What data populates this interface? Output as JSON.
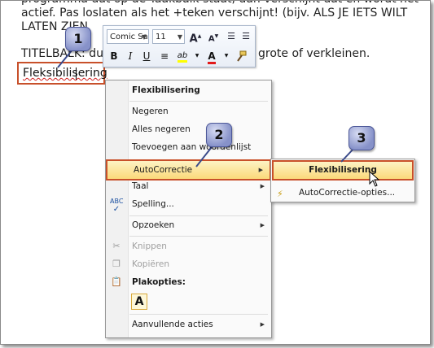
{
  "document": {
    "lines": [
      "programma dat op de Taakbalk staat, dan verschijnt dat en wordt het",
      "actief. Pas loslaten als het +teken verschijnt! (bijv. ALS JE IETS WILT",
      "LATEN ZIEN"
    ],
    "titelbalk_start": "TITELBALK: du",
    "titelbalk_end": "grote of verkleinen.",
    "selected_word": "Fleksibilisering"
  },
  "mini_toolbar": {
    "font_name": "Comic Sa",
    "font_size": "11",
    "buttons": [
      "grow-font",
      "shrink-font",
      "decrease-indent",
      "increase-indent",
      "bold",
      "italic",
      "underline",
      "center",
      "highlight",
      "font-color",
      "format-painter"
    ],
    "labels": {
      "grow": "A",
      "shrink": "A",
      "bold": "B",
      "italic": "I",
      "underline": "U",
      "highlight": "ab",
      "font_color": "A"
    },
    "colors": {
      "highlight": "#ffff00",
      "font_color": "#e21a1a"
    }
  },
  "context_menu": {
    "header": "Flexibilisering",
    "items": [
      {
        "label": "Negeren"
      },
      {
        "label": "Alles negeren"
      },
      {
        "label": "Toevoegen aan woordenlijst"
      },
      {
        "label": "AutoCorrectie",
        "submenu": true,
        "highlighted": true
      },
      {
        "label": "Taal",
        "submenu": true
      },
      {
        "label": "Spelling..."
      },
      {
        "label": "Opzoeken",
        "submenu": true
      },
      {
        "label": "Knippen",
        "disabled": true
      },
      {
        "label": "Kopiëren",
        "disabled": true
      },
      {
        "label": "Plakopties:",
        "bold": true
      },
      {
        "label": "Aanvullende acties",
        "submenu": true
      }
    ],
    "paste_option": "A"
  },
  "submenu": {
    "suggestion": "Flexibilisering",
    "options_label": "AutoCorrectie-opties..."
  },
  "callouts": [
    "1",
    "2",
    "3"
  ],
  "colors": {
    "highlight_border": "#c8502a",
    "highlight_fill": "#fbd97a",
    "badge": "#8792c9"
  }
}
